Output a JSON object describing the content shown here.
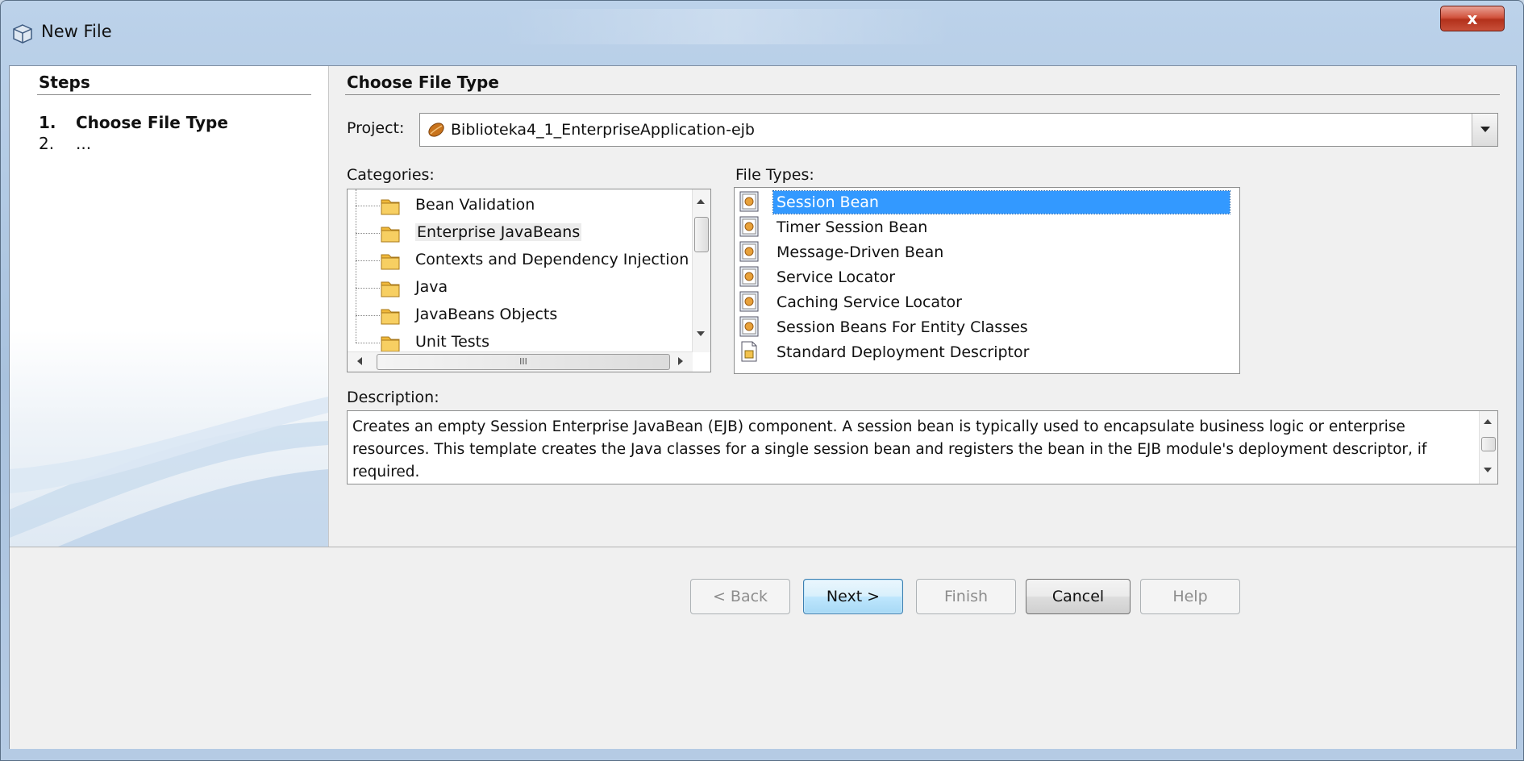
{
  "window": {
    "title": "New File",
    "close_glyph": "x"
  },
  "steps": {
    "header": "Steps",
    "items": [
      {
        "num": "1.",
        "label": "Choose File Type",
        "current": true
      },
      {
        "num": "2.",
        "label": "...",
        "current": false
      }
    ]
  },
  "main": {
    "header": "Choose File Type",
    "project": {
      "label": "Project:",
      "value": "Biblioteka4_1_EnterpriseApplication-ejb"
    },
    "categories": {
      "label": "Categories:",
      "items": [
        "Bean Validation",
        "Enterprise JavaBeans",
        "Contexts and Dependency Injection",
        "Java",
        "JavaBeans Objects",
        "Unit Tests"
      ],
      "selected": "Enterprise JavaBeans",
      "hscroll_glyph": "III"
    },
    "file_types": {
      "label": "File Types:",
      "items": [
        "Session Bean",
        "Timer Session Bean",
        "Message-Driven Bean",
        "Service Locator",
        "Caching Service Locator",
        "Session Beans For Entity Classes",
        "Standard Deployment Descriptor"
      ],
      "selected": "Session Bean"
    },
    "description": {
      "label": "Description:",
      "text": "Creates an empty Session Enterprise JavaBean (EJB) component. A session bean is typically used to encapsulate business logic or enterprise resources. This template creates the Java classes for a single session bean and registers the bean in the EJB module's deployment descriptor, if required."
    }
  },
  "buttons": {
    "back": "< Back",
    "next": "Next >",
    "finish": "Finish",
    "cancel": "Cancel",
    "help": "Help"
  },
  "colors": {
    "selection": "#3399ff",
    "title_bar": "#bcd2ea",
    "close_button": "#c8503a"
  }
}
